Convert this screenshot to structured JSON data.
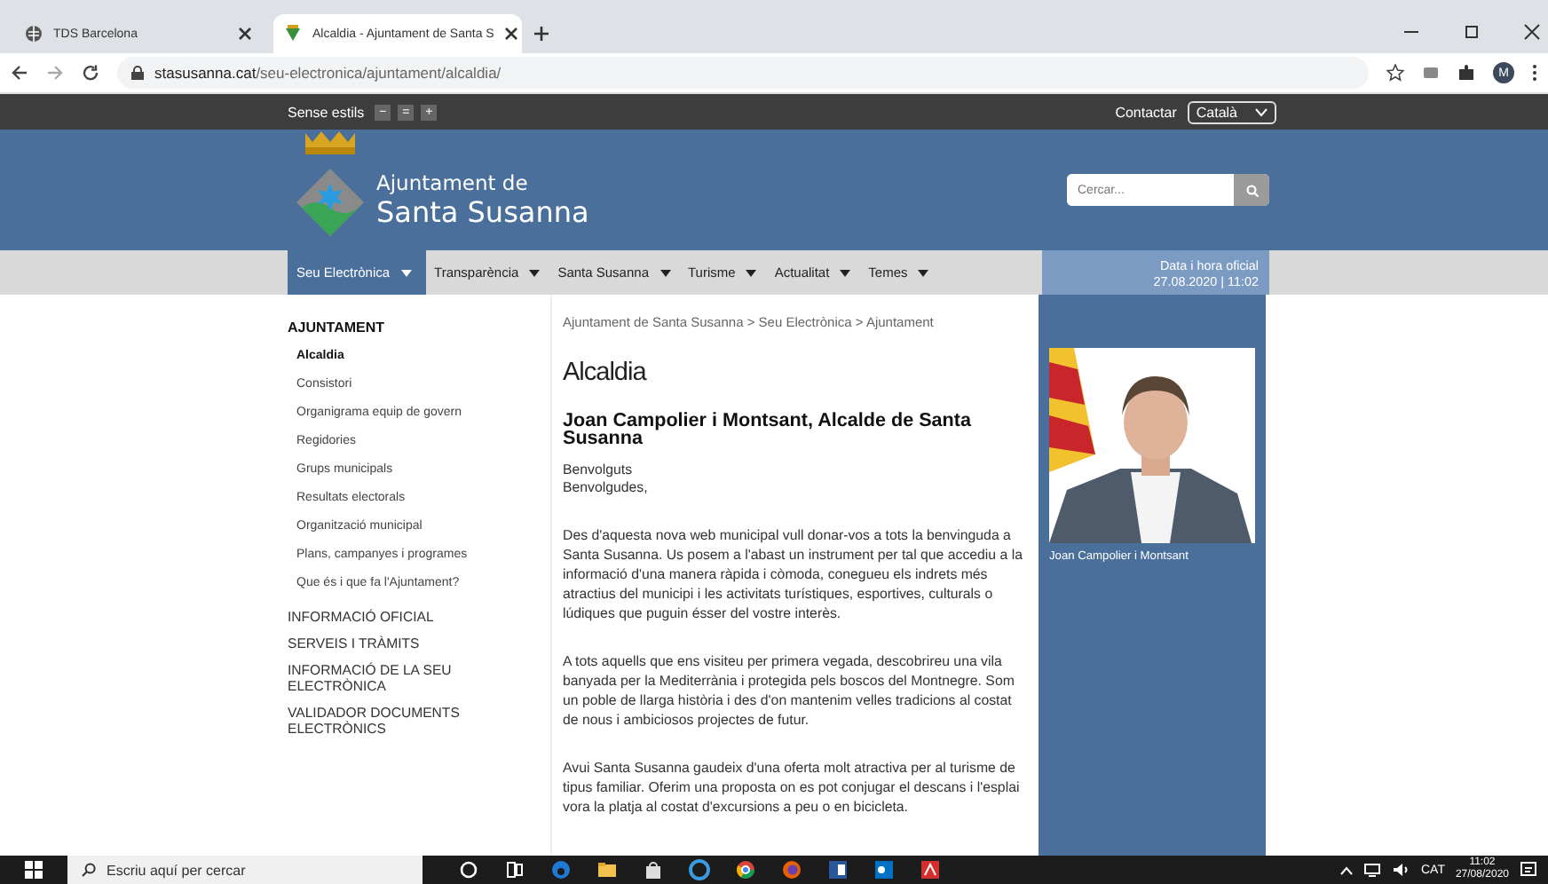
{
  "browser": {
    "tabs": [
      {
        "title": "TDS Barcelona",
        "selected": false
      },
      {
        "title": "Alcaldia - Ajuntament de Santa S",
        "selected": true
      }
    ],
    "url_host": "stasusanna.cat",
    "url_path": "/seu-electronica/ajuntament/alcaldia/",
    "profile": "M"
  },
  "topbar": {
    "styles_label": "Sense estils",
    "font_buttons": [
      "−",
      "=",
      "+"
    ],
    "contact": "Contactar",
    "language": "Català"
  },
  "header": {
    "logo_line1": "Ajuntament de",
    "logo_line2": "Santa Susanna",
    "search": {
      "placeholder": "Cercar..."
    }
  },
  "nav": {
    "items": [
      {
        "label": "Seu Electrònica",
        "selected": true
      },
      {
        "label": "Transparència",
        "selected": false
      },
      {
        "label": "Santa Susanna",
        "selected": false
      },
      {
        "label": "Turisme",
        "selected": false
      },
      {
        "label": "Actualitat",
        "selected": false
      },
      {
        "label": "Temes",
        "selected": false
      }
    ],
    "datetime": {
      "label": "Data i hora oficial",
      "value": "27.08.2020 | 11:02"
    }
  },
  "sidebar": {
    "title": "AJUNTAMENT",
    "items": [
      {
        "label": "Alcaldia",
        "selected": true
      },
      {
        "label": "Consistori",
        "selected": false
      },
      {
        "label": "Organigrama equip de govern",
        "selected": false
      },
      {
        "label": "Regidories",
        "selected": false
      },
      {
        "label": "Grups municipals",
        "selected": false
      },
      {
        "label": "Resultats electorals",
        "selected": false
      },
      {
        "label": "Organització municipal",
        "selected": false
      },
      {
        "label": "Plans, campanyes i programes",
        "selected": false
      },
      {
        "label": "Que és i que fa l'Ajuntament?",
        "selected": false
      }
    ],
    "sections": [
      "INFORMACIÓ OFICIAL",
      "SERVEIS I TRÀMITS",
      "INFORMACIÓ DE LA SEU ELECTRÒNICA",
      "VALIDADOR DOCUMENTS ELECTRÒNICS"
    ]
  },
  "main": {
    "breadcrumb": "Ajuntament de Santa Susanna > Seu Electrònica > Ajuntament",
    "title": "Alcaldia",
    "subtitle": "Joan Campolier i Montsant, Alcalde de Santa Susanna",
    "greeting": [
      "Benvolguts",
      "Benvolgudes,"
    ],
    "paragraphs": [
      "Des d'aquesta nova web municipal vull donar-vos a tots la benvinguda a Santa Susanna. Us posem a l'abast un instrument per tal que accediu a la informació d'una manera ràpida i còmoda, conegueu els indrets més atractius del municipi i les activitats turístiques, esportives, culturals o lúdiques que puguin ésser del vostre interès.",
      "A tots aquells que ens visiteu per primera vegada, descobrireu una vila banyada per la Mediterrània i protegida pels boscos del Montnegre. Som un poble de llarga història i des d'on mantenim velles tradicions al costat de nous i ambiciosos projectes de futur.",
      "Avui Santa Susanna gaudeix d'una oferta molt atractiva per al turisme de tipus familiar. Oferim una proposta on es pot conjugar el descans i l'esplai vora la platja al costat d'excursions a peu o en bicicleta."
    ]
  },
  "aside": {
    "caption": "Joan Campolier i Montsant"
  },
  "taskbar": {
    "search": {
      "placeholder": "Escriu aquí per cercar"
    },
    "language": "CAT",
    "time": "11:02",
    "date": "27/08/2020"
  }
}
